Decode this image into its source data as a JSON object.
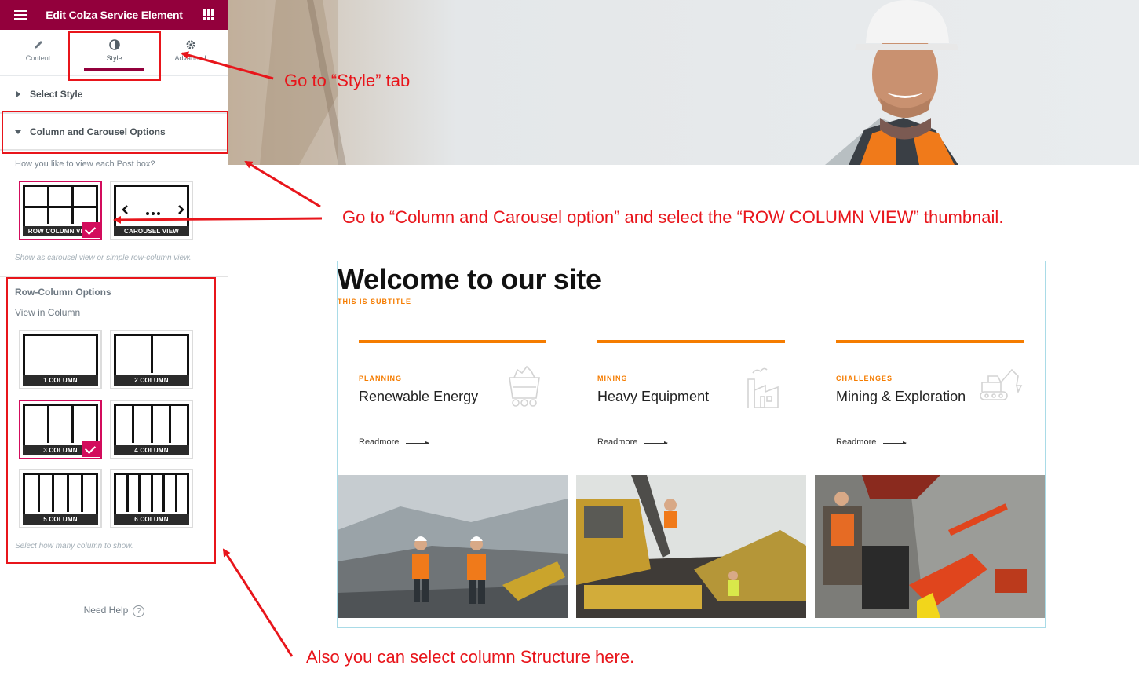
{
  "panel": {
    "title": "Edit Colza Service Element",
    "tabs": [
      {
        "label": "Content",
        "icon": "pencil-icon"
      },
      {
        "label": "Style",
        "icon": "half-circle-icon",
        "active": true
      },
      {
        "label": "Advanced",
        "icon": "gear-icon"
      }
    ],
    "sections": {
      "select_style": "Select Style",
      "column_carousel": "Column and Carousel Options"
    },
    "post_box_question": "How you like to view each Post box?",
    "view_options": [
      {
        "label": "ROW COLUMN VIEW",
        "selected": true
      },
      {
        "label": "CAROUSEL VIEW",
        "selected": false
      }
    ],
    "view_hint": "Show as carousel view or simple row-column view.",
    "row_column_title": "Row-Column Options",
    "view_in_column_label": "View in Column",
    "column_options": [
      {
        "label": "1 COLUMN",
        "cols": 1,
        "selected": false
      },
      {
        "label": "2 COLUMN",
        "cols": 2,
        "selected": false
      },
      {
        "label": "3 COLUMN",
        "cols": 3,
        "selected": true
      },
      {
        "label": "4 COLUMN",
        "cols": 4,
        "selected": false
      },
      {
        "label": "5 COLUMN",
        "cols": 5,
        "selected": false
      },
      {
        "label": "6 COLUMN",
        "cols": 6,
        "selected": false
      }
    ],
    "column_hint": "Select how many column to show.",
    "need_help": "Need Help",
    "help_icon": "?"
  },
  "preview": {
    "heading": "Welcome to our site",
    "subtitle": "THIS IS SUBTITLE",
    "services": [
      {
        "category": "PLANNING",
        "title": "Renewable Energy",
        "readmore": "Readmore",
        "icon": "mine-cart-icon"
      },
      {
        "category": "MINING",
        "title": "Heavy Equipment",
        "readmore": "Readmore",
        "icon": "factory-icon"
      },
      {
        "category": "CHALLENGES",
        "title": "Mining & Exploration",
        "readmore": "Readmore",
        "icon": "excavator-icon"
      }
    ],
    "photos": [
      "mining-workers-photo",
      "mining-machinery-photo",
      "drilling-rig-photo"
    ]
  },
  "annotations": {
    "style_tab": "Go  to “Style” tab",
    "column_option": "Go to “Column and Carousel option” and select the “ROW COLUMN VIEW” thumbnail.",
    "column_structure": "Also you can select column Structure here."
  },
  "colors": {
    "header": "#93003c",
    "accent": "#f57c00",
    "selected": "#d30c5c",
    "annotation": "#e8151b"
  }
}
